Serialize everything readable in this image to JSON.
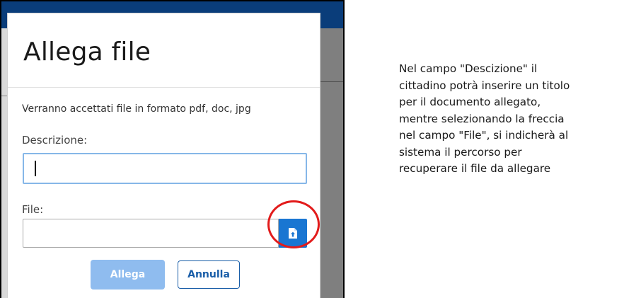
{
  "dialog": {
    "title": "Allega file",
    "note": "Verranno accettati file in formato pdf, doc, jpg",
    "description_label": "Descrizione:",
    "description_value": "",
    "file_label": "File:",
    "file_value": "",
    "upload_icon": "file-upload-icon",
    "attach_label": "Allega",
    "cancel_label": "Annulla"
  },
  "explanation": {
    "lines": [
      "Nel campo \"Descizione\" il",
      "cittadino potrà inserire un titolo",
      "per il documento allegato,",
      "mentre selezionando la freccia",
      "nel campo \"File\",  si indicherà al",
      "sistema il percorso per",
      "recuperare il file da allegare"
    ]
  },
  "colors": {
    "header": "#0a3d7a",
    "primary_button": "#1976d2",
    "disabled_button": "#8fbcef",
    "highlight_circle": "#e21b1b"
  }
}
